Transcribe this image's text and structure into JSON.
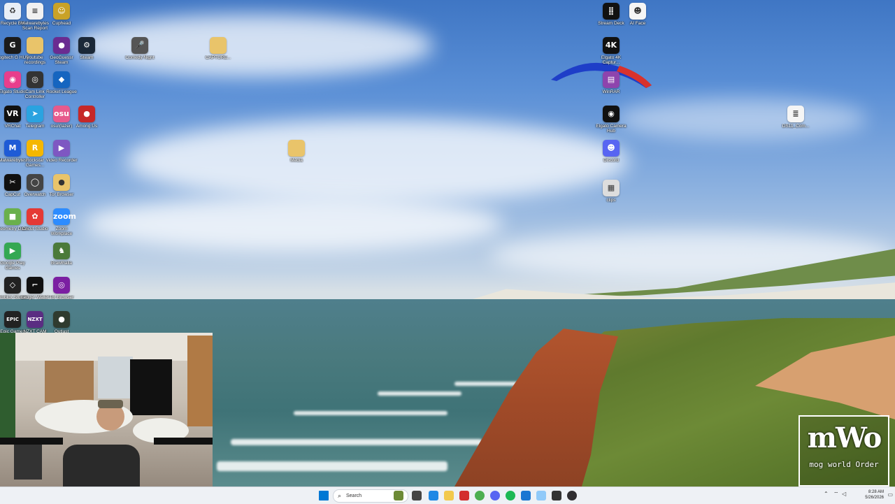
{
  "desktop_icons": [
    {
      "label": "Recycle Bin",
      "icon": "recycle-bin-icon",
      "color": "#e8eef6"
    },
    {
      "label": "Malwarebytes\nScan Report",
      "icon": "document-icon",
      "color": "#f1f1f1"
    },
    {
      "label": "Cuphead",
      "icon": "game-icon",
      "color": "#c9a227"
    },
    {
      "label": "Logitech G HUB",
      "icon": "logitech-icon",
      "color": "#1b1b1b"
    },
    {
      "label": "youtube recordings",
      "icon": "folder-icon",
      "color": "#e9c46a"
    },
    {
      "label": "GeoGuessr Steam",
      "icon": "map-pin-icon",
      "color": "#6a2c91"
    },
    {
      "label": "Steam",
      "icon": "steam-icon",
      "color": "#1b2838"
    },
    {
      "label": "Comedy Night",
      "icon": "microphone-icon",
      "color": "#555555"
    },
    {
      "label": "CAPTURE...",
      "icon": "folder-icon",
      "color": "#e9c46a"
    },
    {
      "label": "Elgato Studio",
      "icon": "elgato-icon",
      "color": "#e83e8c"
    },
    {
      "label": "Cam Link Controller",
      "icon": "camera-icon",
      "color": "#333333"
    },
    {
      "label": "Rocket League",
      "icon": "rocket-league-icon",
      "color": "#1565c0"
    },
    {
      "label": "VRChat",
      "icon": "vr-icon",
      "color": "#111111"
    },
    {
      "label": "Telegram",
      "icon": "telegram-icon",
      "color": "#2aa3e0"
    },
    {
      "label": "osu!(lazer)",
      "icon": "osu-icon",
      "color": "#e75a8c"
    },
    {
      "label": "Among Us",
      "icon": "among-us-icon",
      "color": "#c62828"
    },
    {
      "label": "Malwarebytes",
      "icon": "malwarebytes-icon",
      "color": "#1e5bd6"
    },
    {
      "label": "Rockstar Games...",
      "icon": "rockstar-icon",
      "color": "#f5b700"
    },
    {
      "label": "Video Recorder",
      "icon": "video-icon",
      "color": "#7e57c2"
    },
    {
      "label": "CapCut",
      "icon": "capcut-icon",
      "color": "#111111"
    },
    {
      "label": "Overwatch",
      "icon": "overwatch-icon",
      "color": "#444444"
    },
    {
      "label": "Tor Browser",
      "icon": "tor-icon",
      "color": "#e9c46a"
    },
    {
      "label": "Geometry Dash",
      "icon": "geometry-dash-icon",
      "color": "#6ab04c"
    },
    {
      "label": "Cricut Studio",
      "icon": "cricut-icon",
      "color": "#e53935"
    },
    {
      "label": "Zoom Workplace",
      "icon": "zoom-icon",
      "color": "#2d8cff"
    },
    {
      "label": "Google Play Games",
      "icon": "google-play-icon",
      "color": "#34a853"
    },
    {
      "label": "Brawlhalla",
      "icon": "brawlhalla-icon",
      "color": "#4b7a3a"
    },
    {
      "label": "Roblox Studio",
      "icon": "roblox-icon",
      "color": "#222222"
    },
    {
      "label": "Ledger Wallet",
      "icon": "ledger-icon",
      "color": "#111111"
    },
    {
      "label": "Tor Browser",
      "icon": "tor-browser-icon",
      "color": "#7b1fa2"
    },
    {
      "label": "Epic Games",
      "icon": "epic-games-icon",
      "color": "#222222"
    },
    {
      "label": "NZXT CAM",
      "icon": "nzxt-icon",
      "color": "#5a2d82"
    },
    {
      "label": "Outlast",
      "icon": "outlast-icon",
      "color": "#2f3b2f"
    },
    {
      "label": "Media",
      "icon": "folder-icon",
      "color": "#e9c46a"
    },
    {
      "label": "Stream Deck",
      "icon": "stream-deck-icon",
      "color": "#111111"
    },
    {
      "label": "AI Face",
      "icon": "ai-face-icon",
      "color": "#f5f5f5"
    },
    {
      "label": "Elgato 4K Captur...",
      "icon": "elgato-4k-icon",
      "color": "#111111"
    },
    {
      "label": "WinRAR",
      "icon": "winrar-icon",
      "color": "#8e44ad"
    },
    {
      "label": "Elgato Camera Hub",
      "icon": "camera-hub-icon",
      "color": "#111111"
    },
    {
      "label": "Discord",
      "icon": "discord-icon",
      "color": "#5865f2"
    },
    {
      "label": "clips",
      "icon": "film-icon",
      "color": "#dddddd"
    },
    {
      "label": "DS11_Com...",
      "icon": "text-file-icon",
      "color": "#f5f5f5"
    }
  ],
  "icon_glyphs": {
    "recycle-bin-icon": "♻",
    "document-icon": "≡",
    "game-icon": "☺",
    "logitech-icon": "G",
    "folder-icon": "",
    "map-pin-icon": "●",
    "steam-icon": "⚙",
    "microphone-icon": "🎤",
    "elgato-icon": "◉",
    "camera-icon": "◎",
    "rocket-league-icon": "◆",
    "vr-icon": "VR",
    "telegram-icon": "➤",
    "osu-icon": "osu",
    "among-us-icon": "●",
    "malwarebytes-icon": "M",
    "rockstar-icon": "R",
    "video-icon": "▶",
    "capcut-icon": "✂",
    "overwatch-icon": "◯",
    "tor-icon": "●",
    "geometry-dash-icon": "■",
    "cricut-icon": "✿",
    "zoom-icon": "zoom",
    "google-play-icon": "▶",
    "brawlhalla-icon": "♞",
    "roblox-icon": "◇",
    "ledger-icon": "⌐",
    "tor-browser-icon": "◎",
    "epic-games-icon": "EPIC",
    "nzxt-icon": "NZXT",
    "outlast-icon": "●",
    "stream-deck-icon": "⣿",
    "ai-face-icon": "☻",
    "elgato-4k-icon": "4K",
    "winrar-icon": "▤",
    "camera-hub-icon": "◉",
    "discord-icon": "☻",
    "film-icon": "▦",
    "text-file-icon": "≣"
  },
  "watermark": {
    "big": "mWo",
    "small": "mog world Order"
  },
  "taskbar": {
    "search_placeholder": "Search",
    "pinned_icons": [
      {
        "icon": "windows-start-icon",
        "color": "#0078d4"
      },
      {
        "icon": "search-icon",
        "color": "#ffffff"
      },
      {
        "icon": "landscape-widget-icon",
        "color": "#6d8a36"
      },
      {
        "icon": "task-view-icon",
        "color": "#444444"
      },
      {
        "icon": "edge-icon",
        "color": "#1e88e5"
      },
      {
        "icon": "file-explorer-icon",
        "color": "#f2c94c"
      },
      {
        "icon": "app-icon-red",
        "color": "#d32f2f"
      },
      {
        "icon": "chrome-icon",
        "color": "#4caf50"
      },
      {
        "icon": "discord-taskbar-icon",
        "color": "#5865f2"
      },
      {
        "icon": "spotify-icon",
        "color": "#1db954"
      },
      {
        "icon": "app-icon-blue",
        "color": "#1976d2"
      },
      {
        "icon": "notepad-icon",
        "color": "#90caf9"
      },
      {
        "icon": "terminal-icon",
        "color": "#333333"
      },
      {
        "icon": "obs-icon",
        "color": "#302e31"
      }
    ],
    "time": "8:28 AM",
    "date": "5/26/2026"
  }
}
